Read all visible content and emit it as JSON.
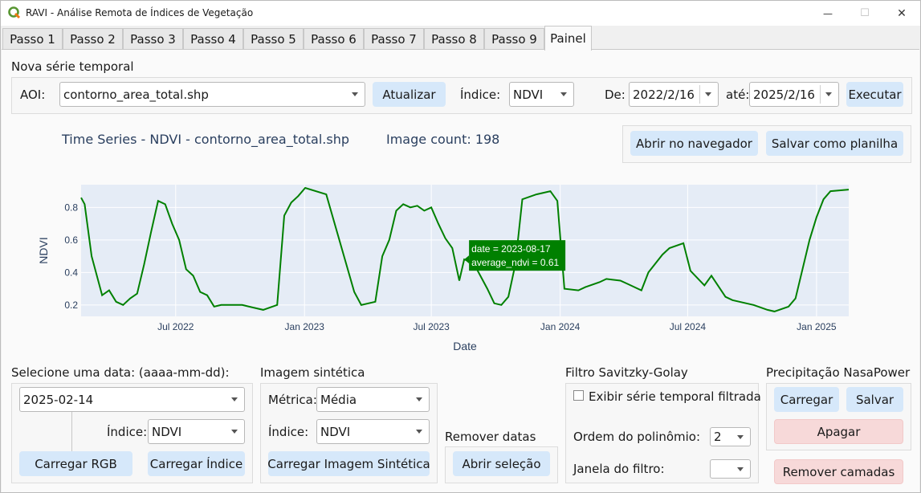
{
  "window": {
    "title": "RAVI - Análise Remota de Índices de Vegetação",
    "minimize": "—",
    "maximize": "☐",
    "close": "✕"
  },
  "tabs": [
    "Passo 1",
    "Passo 2",
    "Passo 3",
    "Passo 4",
    "Passo 5",
    "Passo 6",
    "Passo 7",
    "Passo 8",
    "Passo 9",
    "Painel"
  ],
  "active_tab": "Painel",
  "series": {
    "section_title": "Nova série temporal",
    "aoi_label": "AOI:",
    "aoi_value": "contorno_area_total.shp",
    "update_button": "Atualizar",
    "index_label": "Índice:",
    "index_value": "NDVI",
    "from_label": "De:",
    "from_value": "2022/2/16",
    "to_label": "até:",
    "to_value": "2025/2/16",
    "run_button": "Executar"
  },
  "chart_header": {
    "title": "Time Series - NDVI - contorno_area_total.shp",
    "image_count": "Image count: 198",
    "open_browser_button": "Abrir no navegador",
    "save_sheet_button": "Salvar como planilha"
  },
  "chart_data": {
    "type": "line",
    "xlabel": "Date",
    "ylabel": "NDVI",
    "x_tick_labels": [
      "Jul 2022",
      "Jan 2023",
      "Jul 2023",
      "Jan 2024",
      "Jul 2024",
      "Jan 2025"
    ],
    "y_tick_labels": [
      "0.2",
      "0.4",
      "0.6",
      "0.8"
    ],
    "ylim": [
      0.13,
      0.94
    ],
    "xlim": [
      "2022-02-16",
      "2025-02-16"
    ],
    "grid": true,
    "line_color": "#008000",
    "series": [
      {
        "x": [
          "2022-02-16",
          "2022-02-21",
          "2022-03-03",
          "2022-03-18",
          "2022-03-28",
          "2022-04-07",
          "2022-04-17",
          "2022-04-27",
          "2022-05-07",
          "2022-05-17",
          "2022-05-27",
          "2022-06-06",
          "2022-06-16",
          "2022-06-26",
          "2022-07-06",
          "2022-07-16",
          "2022-07-26",
          "2022-08-05",
          "2022-08-15",
          "2022-08-25",
          "2022-09-04",
          "2022-09-24",
          "2022-10-04",
          "2022-10-14",
          "2022-11-03",
          "2022-11-23",
          "2022-12-03",
          "2022-12-13",
          "2022-12-23",
          "2023-01-02",
          "2023-02-01",
          "2023-03-13",
          "2023-03-23",
          "2023-04-12",
          "2023-04-22",
          "2023-05-02",
          "2023-05-12",
          "2023-05-22",
          "2023-06-01",
          "2023-06-11",
          "2023-06-21",
          "2023-07-01",
          "2023-07-11",
          "2023-07-21",
          "2023-07-31",
          "2023-08-10",
          "2023-08-17",
          "2023-08-30",
          "2023-09-09",
          "2023-09-19",
          "2023-09-29",
          "2023-10-09",
          "2023-10-19",
          "2023-10-29",
          "2023-11-08",
          "2023-11-28",
          "2023-12-18",
          "2023-12-28",
          "2024-01-07",
          "2024-01-27",
          "2024-02-06",
          "2024-02-26",
          "2024-03-07",
          "2024-03-27",
          "2024-04-06",
          "2024-04-26",
          "2024-05-06",
          "2024-05-26",
          "2024-06-05",
          "2024-06-25",
          "2024-07-05",
          "2024-07-25",
          "2024-08-04",
          "2024-08-24",
          "2024-09-03",
          "2024-09-23",
          "2024-10-03",
          "2024-10-23",
          "2024-11-02",
          "2024-11-22",
          "2024-12-02",
          "2024-12-22",
          "2025-01-01",
          "2025-01-11",
          "2025-01-21",
          "2025-02-16"
        ],
        "y": [
          0.86,
          0.82,
          0.5,
          0.26,
          0.29,
          0.22,
          0.2,
          0.24,
          0.27,
          0.45,
          0.65,
          0.84,
          0.82,
          0.7,
          0.6,
          0.42,
          0.38,
          0.28,
          0.26,
          0.19,
          0.2,
          0.2,
          0.2,
          0.19,
          0.17,
          0.2,
          0.75,
          0.83,
          0.87,
          0.92,
          0.88,
          0.28,
          0.2,
          0.22,
          0.5,
          0.6,
          0.78,
          0.82,
          0.8,
          0.81,
          0.78,
          0.8,
          0.7,
          0.61,
          0.55,
          0.35,
          0.48,
          0.46,
          0.38,
          0.3,
          0.21,
          0.2,
          0.25,
          0.45,
          0.85,
          0.88,
          0.9,
          0.84,
          0.3,
          0.29,
          0.31,
          0.34,
          0.36,
          0.35,
          0.33,
          0.29,
          0.4,
          0.51,
          0.55,
          0.58,
          0.41,
          0.32,
          0.38,
          0.25,
          0.23,
          0.21,
          0.2,
          0.17,
          0.16,
          0.19,
          0.24,
          0.6,
          0.74,
          0.85,
          0.9,
          0.91
        ]
      }
    ],
    "tooltip": {
      "line1": "date = 2023-08-17",
      "line2": "average_ndvi = 0.61"
    }
  },
  "date_select": {
    "title": "Selecione uma data: (aaaa-mm-dd):",
    "date_value": "2025-02-14",
    "index_label": "Índice:",
    "index_value": "NDVI",
    "load_rgb": "Carregar RGB",
    "load_index": "Carregar Índice"
  },
  "synthetic": {
    "title": "Imagem sintética",
    "metric_label": "Métrica:",
    "metric_value": "Média",
    "index_label": "Índice:",
    "index_value": "NDVI",
    "load_button": "Carregar Imagem Sintética"
  },
  "remove_dates": {
    "title": "Remover datas",
    "open_selection": "Abrir seleção"
  },
  "savgol": {
    "title": "Filtro Savitzky-Golay",
    "show_filtered": "Exibir série temporal filtrada",
    "poly_order_label": "Ordem do polinômio:",
    "poly_order_value": "2",
    "window_label": "Janela do filtro:",
    "window_value": ""
  },
  "precip": {
    "title": "Precipitação NasaPower",
    "load": "Carregar",
    "save": "Salvar",
    "delete": "Apagar",
    "remove_layers": "Remover camadas"
  }
}
